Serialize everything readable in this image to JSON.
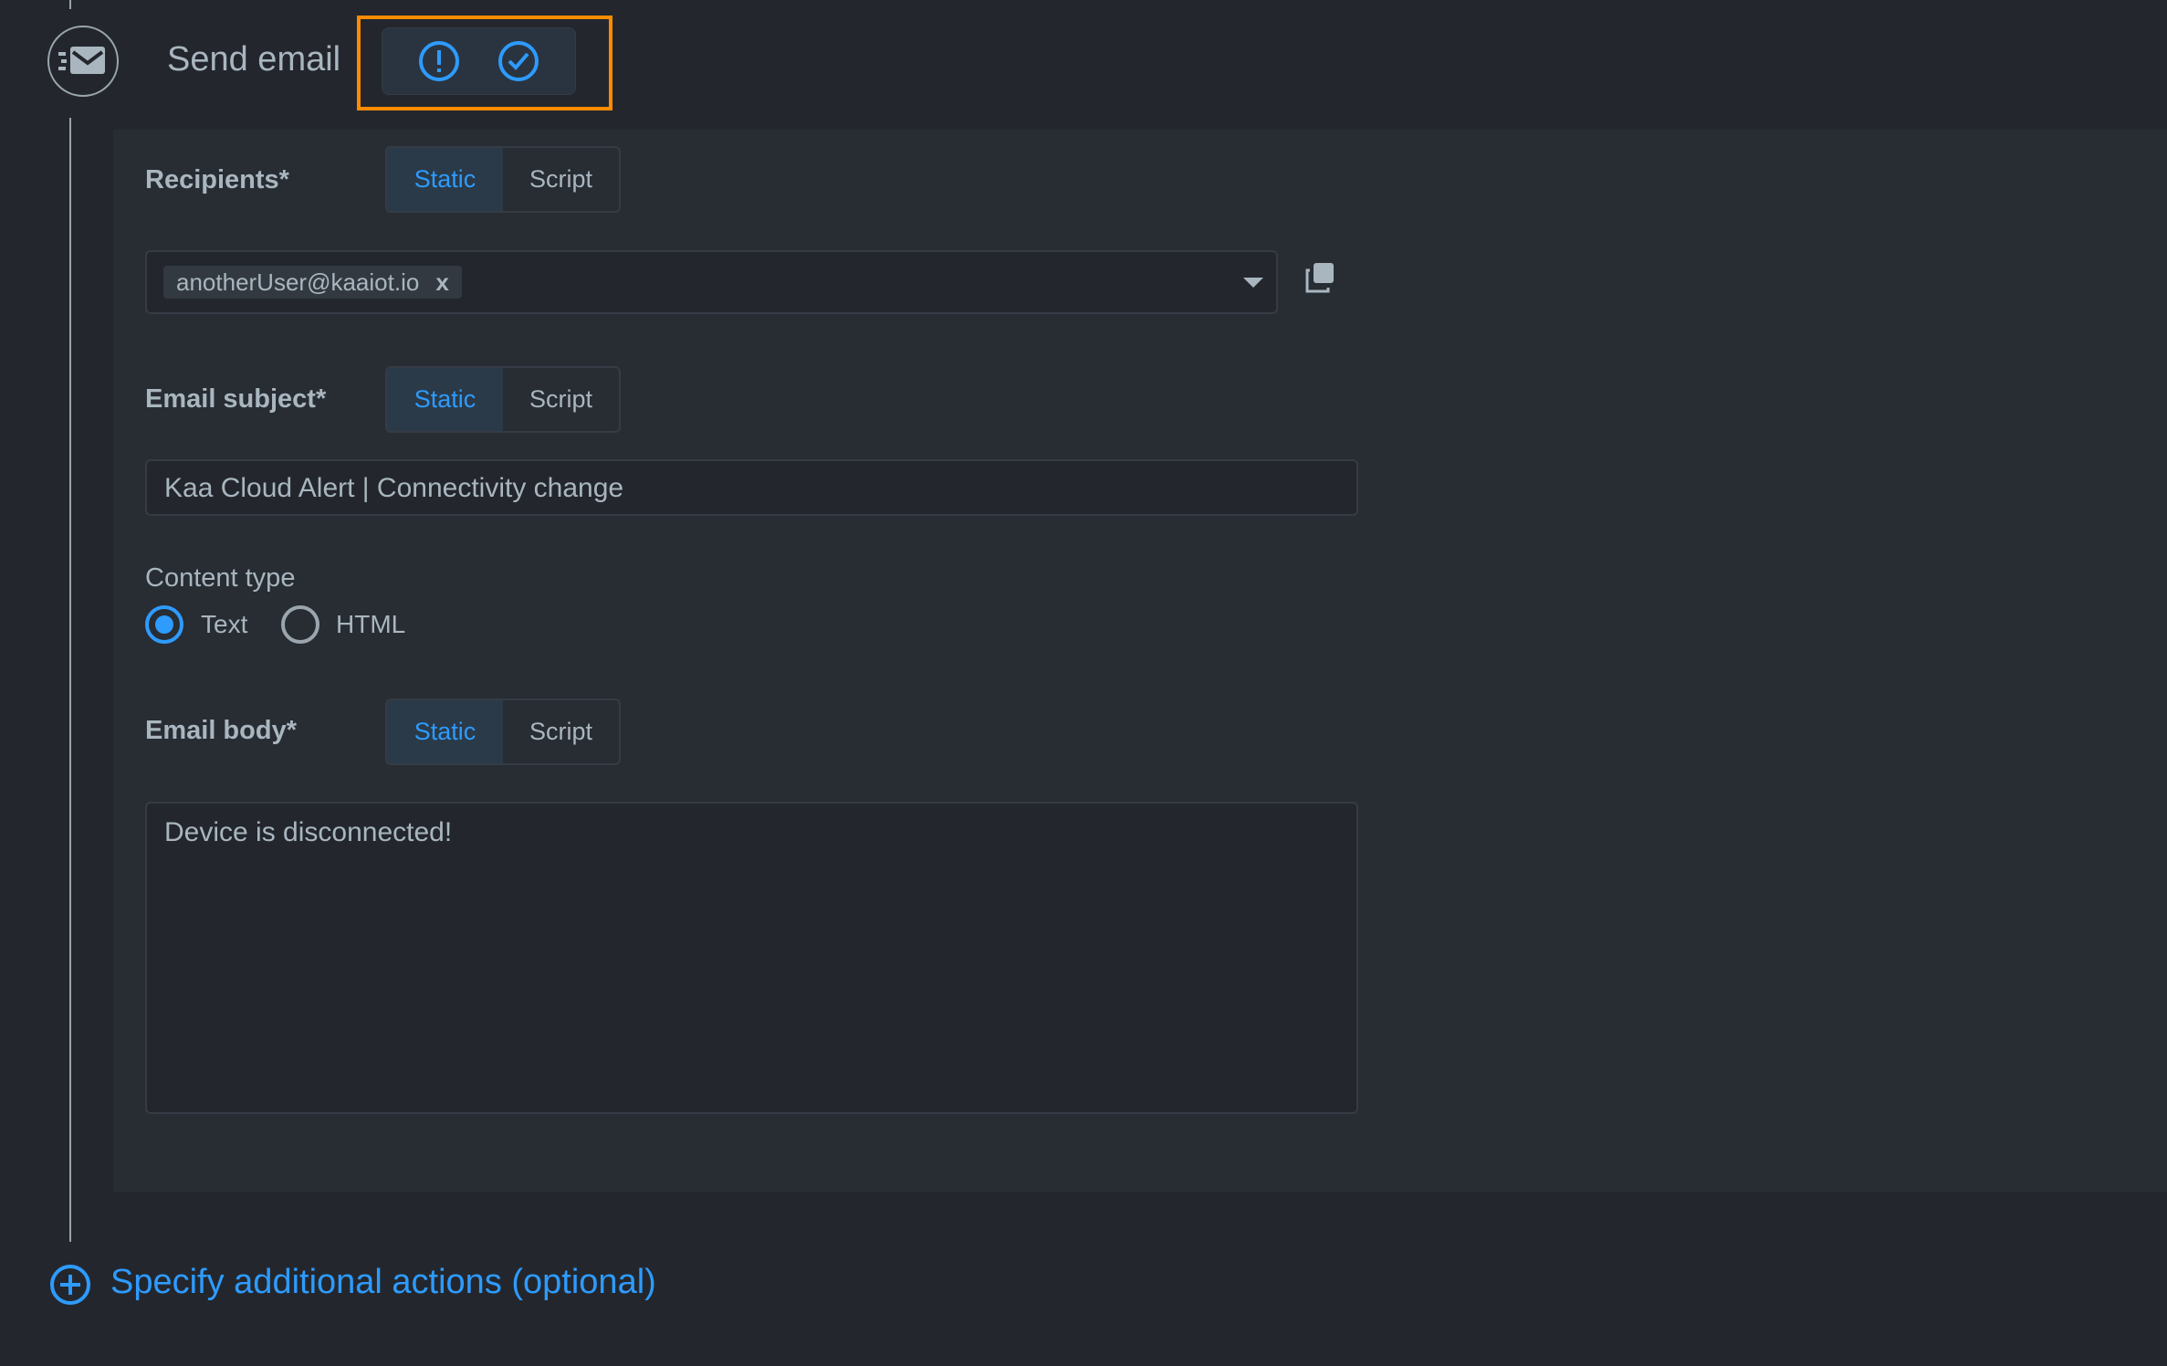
{
  "header": {
    "title": "Send email",
    "icon": "email-send-icon",
    "status_icons": [
      "alert-circle-icon",
      "check-circle-icon"
    ],
    "highlight_color": "#ff8c00"
  },
  "recipients": {
    "label": "Recipients*",
    "toggle": {
      "static": "Static",
      "script": "Script",
      "selected": "Static"
    },
    "chips": [
      "anotherUser@kaaiot.io"
    ],
    "chip_remove": "x"
  },
  "subject": {
    "label": "Email subject*",
    "toggle": {
      "static": "Static",
      "script": "Script",
      "selected": "Static"
    },
    "value": "Kaa Cloud Alert | Connectivity change"
  },
  "content_type": {
    "label": "Content type",
    "options": [
      "Text",
      "HTML"
    ],
    "selected": "Text"
  },
  "body": {
    "label": "Email body*",
    "toggle": {
      "static": "Static",
      "script": "Script",
      "selected": "Static"
    },
    "value": "Device is disconnected!"
  },
  "footer": {
    "add_actions": "Specify additional actions (optional)"
  },
  "colors": {
    "accent": "#2e9bff",
    "background": "#23272d",
    "panel": "#282c33"
  }
}
